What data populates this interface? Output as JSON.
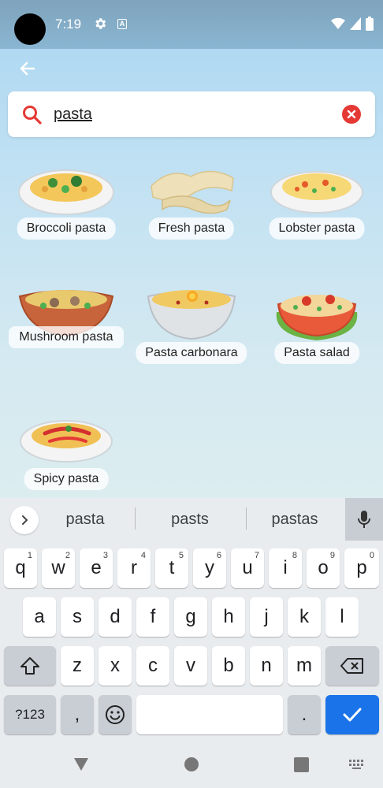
{
  "status_bar": {
    "time": "7:19"
  },
  "search": {
    "query": "pasta"
  },
  "dishes": [
    {
      "label": "Broccoli pasta"
    },
    {
      "label": "Fresh pasta"
    },
    {
      "label": "Lobster pasta"
    },
    {
      "label": "Mushroom pasta"
    },
    {
      "label": "Pasta carbonara"
    },
    {
      "label": "Pasta salad"
    },
    {
      "label": "Spicy pasta"
    }
  ],
  "keyboard": {
    "suggestions": [
      "pasta",
      "pasts",
      "pastas"
    ],
    "row1": [
      {
        "key": "q",
        "num": "1"
      },
      {
        "key": "w",
        "num": "2"
      },
      {
        "key": "e",
        "num": "3"
      },
      {
        "key": "r",
        "num": "4"
      },
      {
        "key": "t",
        "num": "5"
      },
      {
        "key": "y",
        "num": "6"
      },
      {
        "key": "u",
        "num": "7"
      },
      {
        "key": "i",
        "num": "8"
      },
      {
        "key": "o",
        "num": "9"
      },
      {
        "key": "p",
        "num": "0"
      }
    ],
    "row2": [
      "a",
      "s",
      "d",
      "f",
      "g",
      "h",
      "j",
      "k",
      "l"
    ],
    "row3": [
      "z",
      "x",
      "c",
      "v",
      "b",
      "n",
      "m"
    ],
    "symbols_label": "?123",
    "comma": ",",
    "period": "."
  }
}
